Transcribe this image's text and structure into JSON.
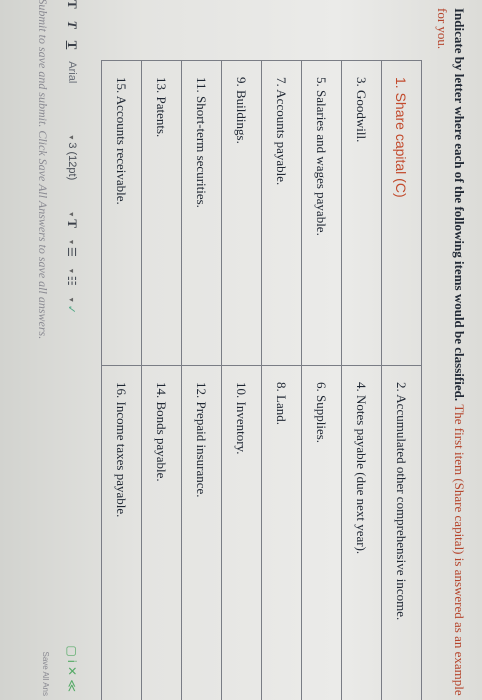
{
  "instruction": {
    "bold_text": "Indicate by letter where each of the following items would be classified.",
    "highlight_text": "The first item (Share capital) is answered as an example for you."
  },
  "items": [
    [
      "1. Share capital (C)",
      "2. Accumulated other comprehensive income."
    ],
    [
      "3. Goodwill.",
      "4. Notes payable (due next year)."
    ],
    [
      "5. Salaries and wages payable.",
      "6. Supplies."
    ],
    [
      "7. Accounts payable.",
      "8. Land."
    ],
    [
      "9. Buildings.",
      "10. Inventory."
    ],
    [
      "11. Short-term securities.",
      "12. Prepaid insurance."
    ],
    [
      "13. Patents.",
      "14. Bonds payable."
    ],
    [
      "15. Accounts receivable.",
      "16. Income taxes payable."
    ]
  ],
  "toolbar": {
    "t1": "T",
    "t2": "T",
    "t3": "T",
    "font": "Arial",
    "size": "3 (12pt)",
    "caret": "▾",
    "list_bullets": "☰",
    "list_numbers": "☷",
    "check": "✓",
    "right_icons": "▢ i ✕ ≪"
  },
  "submit": {
    "text": "Click Submit to save and submit. Click Save All Answers to save all answers.",
    "save_all": "Save All Ans"
  },
  "colors": {
    "accent_red": "#c24a2c",
    "text_dark": "#1f2733"
  }
}
